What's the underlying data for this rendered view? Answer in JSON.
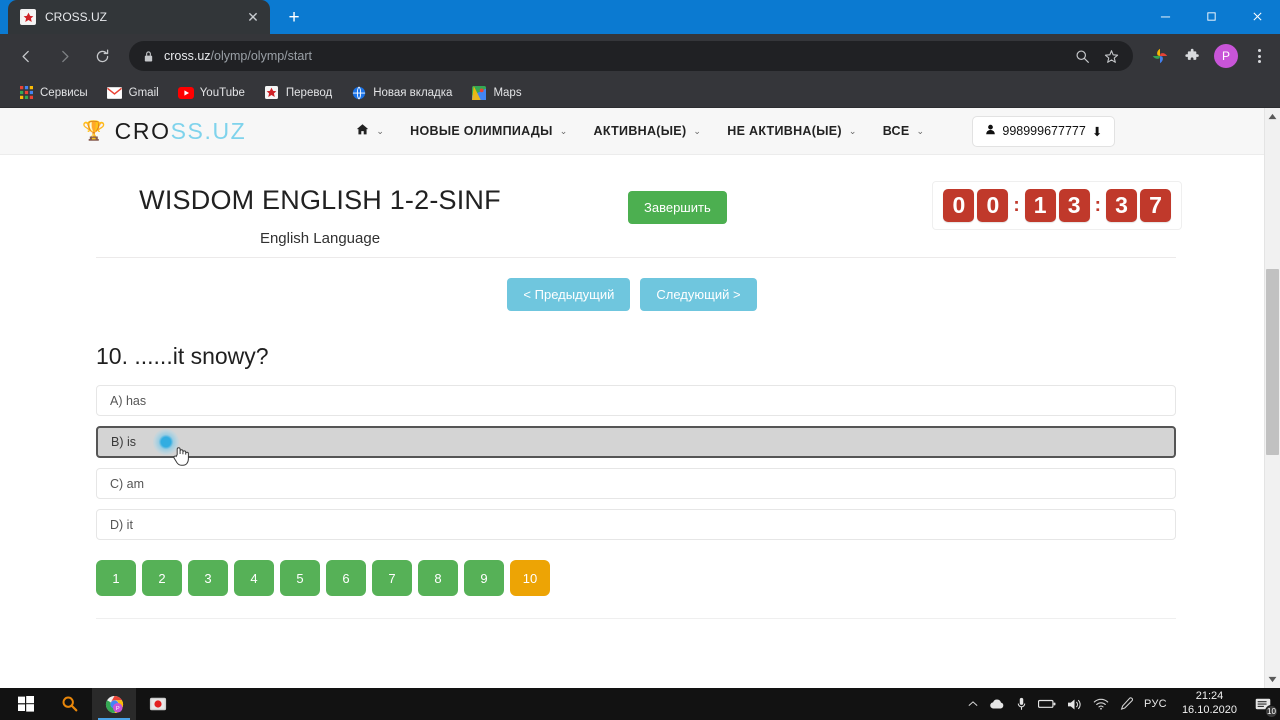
{
  "browser": {
    "tab": {
      "title": "CROSS.UZ",
      "favicon_name": "cross-favicon",
      "close_label": "✕"
    },
    "new_tab_label": "+",
    "window_controls": {
      "minimize": "minimize-icon",
      "maximize": "maximize-icon",
      "close": "close-icon"
    },
    "toolbar": {
      "back": "back-icon",
      "forward": "forward-icon",
      "reload": "reload-icon",
      "url_domain": "cross.uz",
      "url_path": "/olymp/olymp/start",
      "zoom_icon": "search-icon",
      "bookmark_icon": "star-icon",
      "ext_photos_icon": "photos-extension-icon",
      "ext_puzzle_icon": "extensions-puzzle-icon",
      "profile_initial": "P",
      "menu_icon": "kebab-menu-icon"
    },
    "bookmarks": [
      {
        "label": "Сервисы",
        "icon": "apps-grid-icon"
      },
      {
        "label": "Gmail",
        "icon": "gmail-icon"
      },
      {
        "label": "YouTube",
        "icon": "youtube-icon"
      },
      {
        "label": "Перевод",
        "icon": "translate-icon"
      },
      {
        "label": "Новая вкладка",
        "icon": "globe-icon"
      },
      {
        "label": "Maps",
        "icon": "maps-icon"
      }
    ]
  },
  "site": {
    "logo": {
      "mark": "🏆",
      "text_dark": "CRO",
      "text_accent": "SS.UZ"
    },
    "nav": [
      {
        "label": "",
        "icon": "home-icon",
        "caret": "⌄"
      },
      {
        "label": "НОВЫЕ ОЛИМПИАДЫ",
        "caret": "⌄"
      },
      {
        "label": "АКТИВНА(ЫЕ)",
        "caret": "⌄"
      },
      {
        "label": "НЕ АКТИВНА(ЫЕ)",
        "caret": "⌄"
      },
      {
        "label": "ВСЕ",
        "caret": "⌄"
      }
    ],
    "user": {
      "phone": "998999677777",
      "person_icon": "person-icon",
      "arrow": "⬇"
    }
  },
  "exam": {
    "title": "WISDOM ENGLISH 1-2-SINF",
    "subject": "English Language",
    "finish_label": "Завершить",
    "timer": {
      "digits": [
        "0",
        "0",
        "1",
        "3",
        "3",
        "7"
      ],
      "separator": ":",
      "value": "00:13:37"
    },
    "prev_label": "< Предыдущий",
    "next_label": "Следующий >",
    "question": {
      "number": "10.",
      "text": "10. ......it snowy?"
    },
    "options": [
      {
        "label": "A) has",
        "selected": false
      },
      {
        "label": "B) is",
        "selected": true
      },
      {
        "label": "C) am",
        "selected": false
      },
      {
        "label": "D) it",
        "selected": false
      }
    ],
    "pager": [
      {
        "label": "1",
        "state": "answered"
      },
      {
        "label": "2",
        "state": "answered"
      },
      {
        "label": "3",
        "state": "answered"
      },
      {
        "label": "4",
        "state": "answered"
      },
      {
        "label": "5",
        "state": "answered"
      },
      {
        "label": "6",
        "state": "answered"
      },
      {
        "label": "7",
        "state": "answered"
      },
      {
        "label": "8",
        "state": "answered"
      },
      {
        "label": "9",
        "state": "answered"
      },
      {
        "label": "10",
        "state": "current"
      }
    ],
    "colors": {
      "finish_green": "#4caf50",
      "nav_blue": "#6fc6de",
      "timer_red": "#c0392b",
      "pager_green": "#56b157",
      "pager_current": "#eda405"
    }
  },
  "taskbar": {
    "items": [
      {
        "icon": "windows-start-icon",
        "name": "start-button"
      },
      {
        "icon": "search-icon",
        "name": "taskbar-search"
      },
      {
        "icon": "chrome-icon",
        "name": "taskbar-chrome"
      },
      {
        "icon": "screen-recorder-icon",
        "name": "taskbar-recorder"
      }
    ],
    "tray": {
      "cloud": "cloud-icon",
      "mic": "microphone-icon",
      "battery": "battery-icon",
      "volume": "volume-icon",
      "wifi": "wifi-icon",
      "pen": "pen-icon",
      "language": "РУС",
      "time": "21:24",
      "date": "16.10.2020",
      "notifications_icon": "notifications-icon",
      "notifications_count": "10"
    }
  }
}
